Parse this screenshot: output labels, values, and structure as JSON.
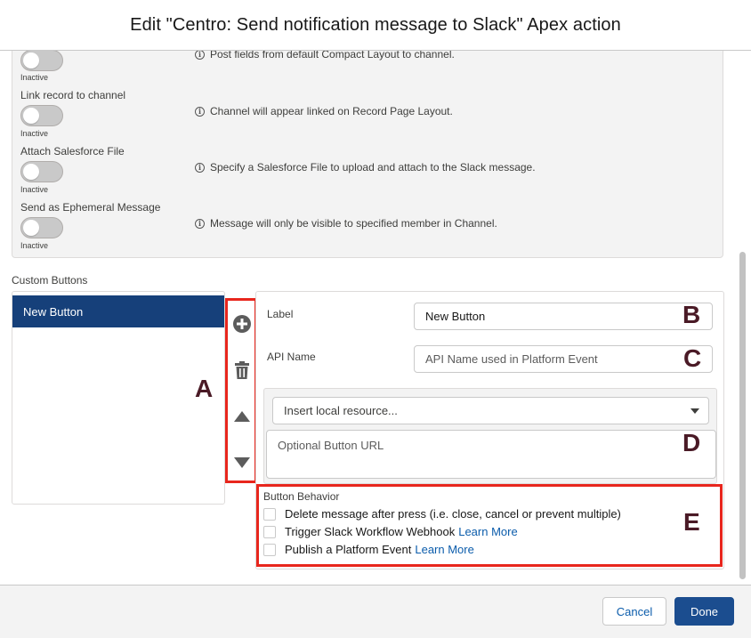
{
  "modal": {
    "title": "Edit \"Centro: Send notification message to Slack\" Apex action"
  },
  "options": [
    {
      "label": "",
      "state": "Inactive",
      "info": "Post fields from default Compact Layout to channel."
    },
    {
      "label": "Link record to channel",
      "state": "Inactive",
      "info": "Channel will appear linked on Record Page Layout."
    },
    {
      "label": "Attach Salesforce File",
      "state": "Inactive",
      "info": "Specify a Salesforce File to upload and attach to the Slack message."
    },
    {
      "label": "Send as Ephemeral Message",
      "state": "Inactive",
      "info": "Message will only be visible to specified member in Channel."
    }
  ],
  "custom_buttons": {
    "heading": "Custom Buttons",
    "items": [
      "New Button"
    ],
    "tools": [
      "add-icon",
      "trash-icon",
      "move-up-icon",
      "move-down-icon"
    ]
  },
  "detail": {
    "label_field": {
      "label": "Label",
      "value": "New Button"
    },
    "api_field": {
      "label": "API Name",
      "placeholder": "API Name used in Platform Event"
    },
    "resource_select": {
      "value": "Insert local resource..."
    },
    "url_field": {
      "placeholder": "Optional Button URL"
    }
  },
  "behavior": {
    "heading": "Button Behavior",
    "options": [
      {
        "label": "Delete message after press (i.e. close, cancel or prevent multiple)",
        "link": "",
        "checked": false
      },
      {
        "label": "Trigger Slack Workflow Webhook",
        "link": "Learn More",
        "checked": false
      },
      {
        "label": "Publish a Platform Event",
        "link": "Learn More",
        "checked": false
      }
    ]
  },
  "annotations": {
    "a": "A",
    "b": "B",
    "c": "C",
    "d": "D",
    "e": "E"
  },
  "footer": {
    "cancel": "Cancel",
    "done": "Done"
  },
  "colors": {
    "highlight": "#e8261d",
    "selected": "#16407a",
    "brand": "#1b4d8f",
    "link": "#0b5cab"
  }
}
